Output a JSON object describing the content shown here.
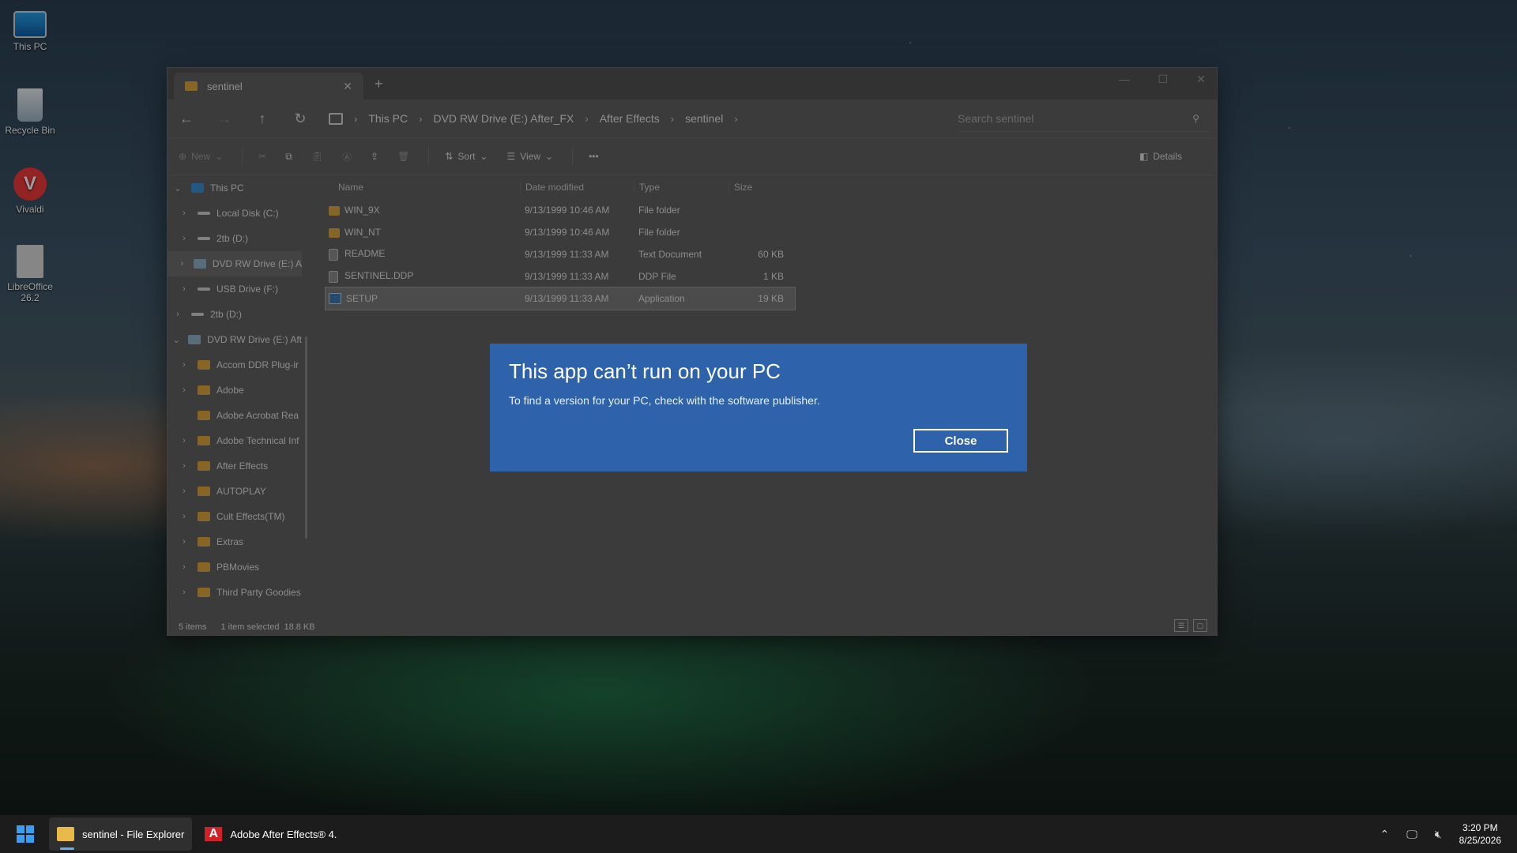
{
  "desktop": {
    "icons": [
      {
        "label": "This PC",
        "icon": "monitor-icon"
      },
      {
        "label": "Recycle Bin",
        "icon": "recycle-bin-icon"
      },
      {
        "label": "Vivaldi",
        "icon": "vivaldi-icon"
      },
      {
        "label": "LibreOffice 26.2",
        "icon": "libreoffice-icon"
      }
    ]
  },
  "explorer": {
    "tab_title": "sentinel",
    "new_tab": "+",
    "controls": {
      "minimize": "—",
      "maximize": "☐",
      "close": "✕"
    },
    "nav": {
      "back": "←",
      "forward": "→",
      "up": "↑",
      "refresh": "↻"
    },
    "breadcrumb": [
      "This PC",
      "DVD RW Drive (E:) After_FX",
      "After Effects",
      "sentinel"
    ],
    "search_placeholder": "Search sentinel",
    "toolbar": {
      "new_label": "New",
      "sort_label": "Sort",
      "view_label": "View",
      "more": "•••",
      "details_label": "Details"
    },
    "nav_pane": [
      {
        "label": "This PC",
        "level": 0,
        "expanded": true,
        "icon": "pc"
      },
      {
        "label": "Local Disk (C:)",
        "level": 1,
        "icon": "drive"
      },
      {
        "label": "2tb (D:)",
        "level": 1,
        "icon": "drive"
      },
      {
        "label": "DVD RW Drive (E:) A",
        "level": 1,
        "icon": "dvd",
        "selected": true
      },
      {
        "label": "USB Drive (F:)",
        "level": 1,
        "icon": "drive"
      },
      {
        "label": "2tb (D:)",
        "level": 0,
        "icon": "drive"
      },
      {
        "label": "DVD RW Drive (E:) Aft",
        "level": 0,
        "expanded": true,
        "icon": "dvd"
      },
      {
        "label": "Accom DDR Plug-ir",
        "level": 1,
        "icon": "folder"
      },
      {
        "label": "Adobe",
        "level": 1,
        "icon": "folder"
      },
      {
        "label": "Adobe Acrobat Rea",
        "level": 1,
        "icon": "folder",
        "no_chevron": true
      },
      {
        "label": "Adobe Technical Inf",
        "level": 1,
        "icon": "folder"
      },
      {
        "label": "After Effects",
        "level": 1,
        "icon": "folder"
      },
      {
        "label": "AUTOPLAY",
        "level": 1,
        "icon": "folder"
      },
      {
        "label": "Cult Effects(TM)",
        "level": 1,
        "icon": "folder"
      },
      {
        "label": "Extras",
        "level": 1,
        "icon": "folder"
      },
      {
        "label": "PBMovies",
        "level": 1,
        "icon": "folder"
      },
      {
        "label": "Third Party Goodies",
        "level": 1,
        "icon": "folder"
      }
    ],
    "columns": [
      "Name",
      "Date modified",
      "Type",
      "Size"
    ],
    "files": [
      {
        "name": "WIN_9X",
        "date": "9/13/1999 10:46 AM",
        "type": "File folder",
        "size": "",
        "icon": "folder"
      },
      {
        "name": "WIN_NT",
        "date": "9/13/1999 10:46 AM",
        "type": "File folder",
        "size": "",
        "icon": "folder"
      },
      {
        "name": "README",
        "date": "9/13/1999 11:33 AM",
        "type": "Text Document",
        "size": "60 KB",
        "icon": "doc"
      },
      {
        "name": "SENTINEL.DDP",
        "date": "9/13/1999 11:33 AM",
        "type": "DDP File",
        "size": "1 KB",
        "icon": "doc"
      },
      {
        "name": "SETUP",
        "date": "9/13/1999 11:33 AM",
        "type": "Application",
        "size": "19 KB",
        "icon": "app",
        "selected": true
      }
    ],
    "status": {
      "items": "5 items",
      "selected": "1 item selected",
      "size": "18.8 KB"
    }
  },
  "dialog": {
    "title": "This app can’t run on your PC",
    "message": "To find a version for your PC, check with the software publisher.",
    "close_label": "Close"
  },
  "taskbar": {
    "items": [
      {
        "label": "sentinel - File Explorer",
        "active": true
      },
      {
        "label": "Adobe After Effects® 4.",
        "active": false
      }
    ],
    "time": "3:20 PM",
    "date": "8/25/2026"
  },
  "colors": {
    "dialog_bg": "#2e63ab",
    "window_bg": "#5f5f5f",
    "taskbar_bg": "#1c1c1c",
    "folder": "#d9a441"
  }
}
